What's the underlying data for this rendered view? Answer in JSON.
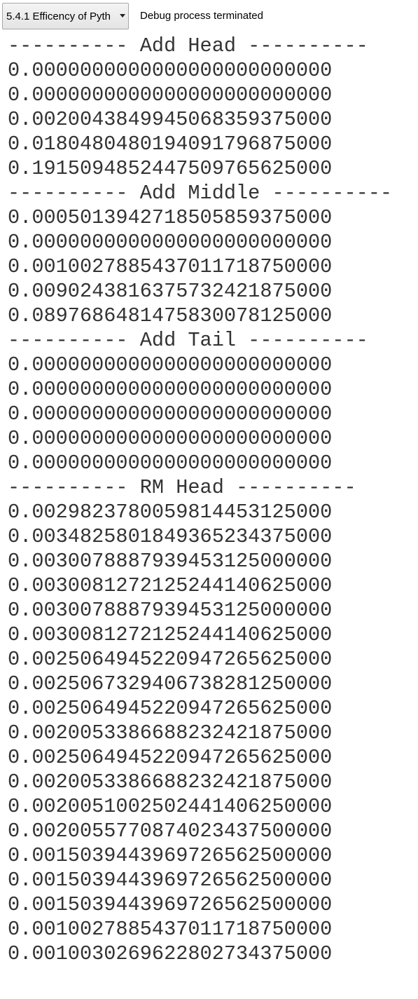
{
  "toolbar": {
    "run_selector": "5.4.1 Efficency of Pyth",
    "status": "Debug process terminated"
  },
  "console": {
    "lines": [
      "---------- Add Head ----------",
      "0.0000000000000000000000000",
      "0.0000000000000000000000000",
      "0.0020043849945068359375000",
      "0.0180480480194091796875000",
      "0.1915094852447509765625000",
      "---------- Add Middle ----------",
      "0.0005013942718505859375000",
      "0.0000000000000000000000000",
      "0.0010027885437011718750000",
      "0.0090243816375732421875000",
      "0.0897686481475830078125000",
      "---------- Add Tail ----------",
      "0.0000000000000000000000000",
      "0.0000000000000000000000000",
      "0.0000000000000000000000000",
      "0.0000000000000000000000000",
      "0.0000000000000000000000000",
      "---------- RM Head ----------",
      "0.0029823780059814453125000",
      "0.0034825801849365234375000",
      "0.0030078887939453125000000",
      "0.0030081272125244140625000",
      "0.0030078887939453125000000",
      "0.0030081272125244140625000",
      "0.0025064945220947265625000",
      "0.0025067329406738281250000",
      "0.0025064945220947265625000",
      "0.0020053386688232421875000",
      "0.0025064945220947265625000",
      "0.0020053386688232421875000",
      "0.0020051002502441406250000",
      "0.0020055770874023437500000",
      "0.0015039443969726562500000",
      "0.0015039443969726562500000",
      "0.0015039443969726562500000",
      "0.0010027885437011718750000",
      "0.0010030269622802734375000"
    ]
  }
}
